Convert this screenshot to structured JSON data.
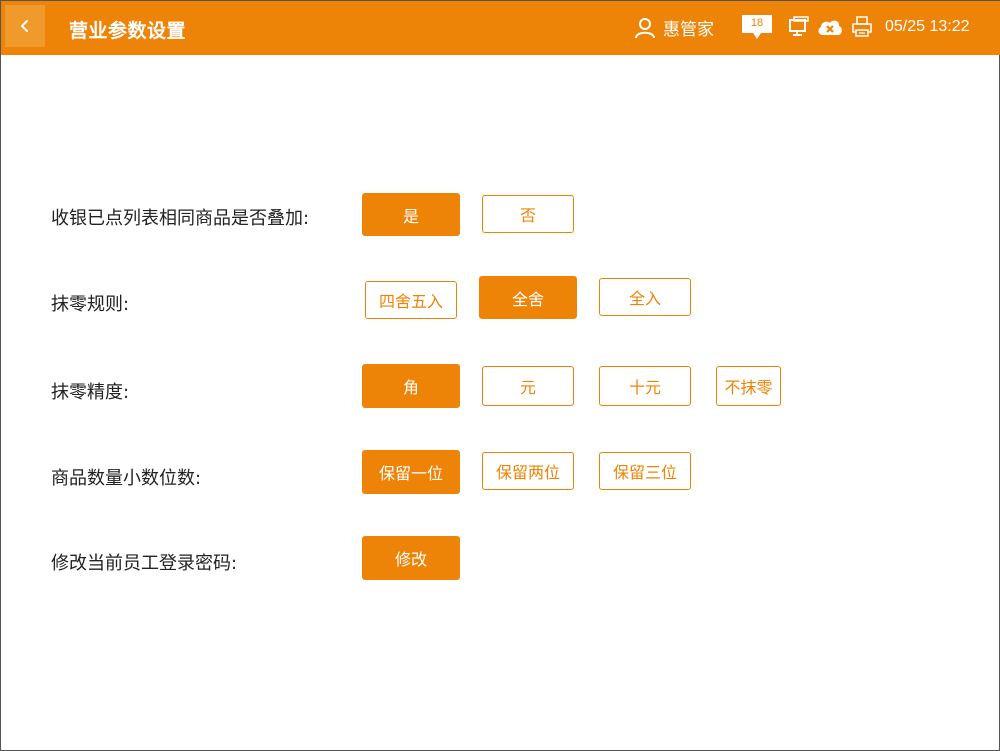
{
  "header": {
    "title": "营业参数设置",
    "user_name": "惠管家",
    "message_count": "18",
    "datetime": "05/25 13:22"
  },
  "theme": {
    "accent": "#ee8407",
    "accent_light": "#f19a2c"
  },
  "settings": [
    {
      "label": "收银已点列表相同商品是否叠加:",
      "options": [
        {
          "text": "是",
          "selected": true
        },
        {
          "text": "否",
          "selected": false
        }
      ]
    },
    {
      "label": "抹零规则:",
      "options": [
        {
          "text": "四舍五入",
          "selected": false
        },
        {
          "text": "全舍",
          "selected": true
        },
        {
          "text": "全入",
          "selected": false
        }
      ]
    },
    {
      "label": "抹零精度:",
      "options": [
        {
          "text": "角",
          "selected": true
        },
        {
          "text": "元",
          "selected": false
        },
        {
          "text": "十元",
          "selected": false
        },
        {
          "text": "不抹零",
          "selected": false
        }
      ]
    },
    {
      "label": "商品数量小数位数:",
      "options": [
        {
          "text": "保留一位",
          "selected": true
        },
        {
          "text": "保留两位",
          "selected": false
        },
        {
          "text": "保留三位",
          "selected": false
        }
      ]
    },
    {
      "label": "修改当前员工登录密码:",
      "options": [
        {
          "text": "修改",
          "selected": true
        }
      ]
    }
  ]
}
